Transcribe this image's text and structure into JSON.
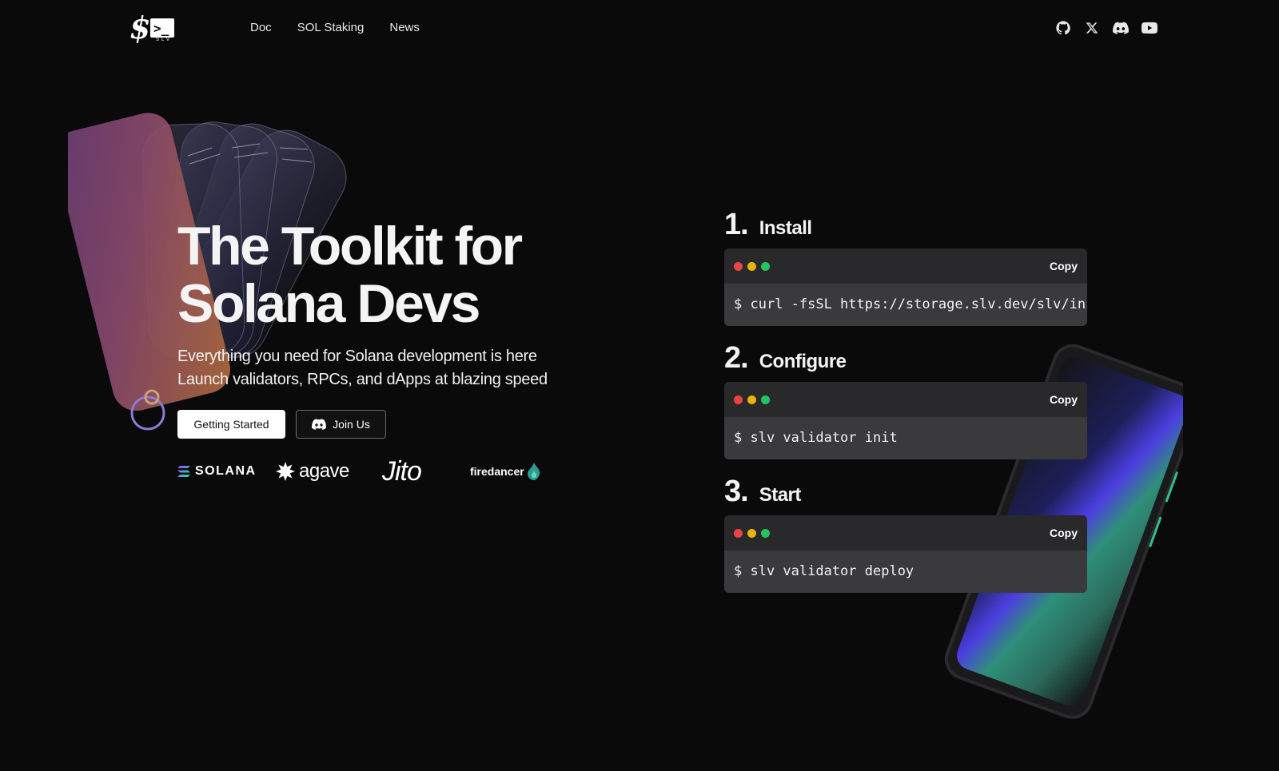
{
  "nav": {
    "logo_alt": "SLV",
    "logo_tag": "SLV",
    "links": [
      "Doc",
      "SOL Staking",
      "News"
    ],
    "social": [
      "github-icon",
      "x-icon",
      "discord-icon",
      "youtube-icon"
    ]
  },
  "hero": {
    "title_line1": "The Toolkit for",
    "title_line2": "Solana Devs",
    "subtitle_line1": "Everything you need for Solana development is here",
    "subtitle_line2": "Launch validators, RPCs, and dApps at blazing speed",
    "primary_button": "Getting Started",
    "secondary_button": "Join Us"
  },
  "partners": {
    "solana": "SOLANA",
    "agave": "agave",
    "jito": "Jito",
    "firedancer": "firedancer"
  },
  "steps": [
    {
      "number": "1.",
      "title": "Install",
      "command": "$ curl -fsSL https://storage.slv.dev/slv/install",
      "copy": "Copy"
    },
    {
      "number": "2.",
      "title": "Configure",
      "command": "$ slv validator init",
      "copy": "Copy"
    },
    {
      "number": "3.",
      "title": "Start",
      "command": "$ slv validator deploy",
      "copy": "Copy"
    }
  ],
  "colors": {
    "background": "#0a0a0a",
    "terminal_header": "#29292b",
    "terminal_body": "#3a3a3c",
    "dot_red": "#ef4444",
    "dot_yellow": "#eab308",
    "dot_green": "#22c55e"
  }
}
